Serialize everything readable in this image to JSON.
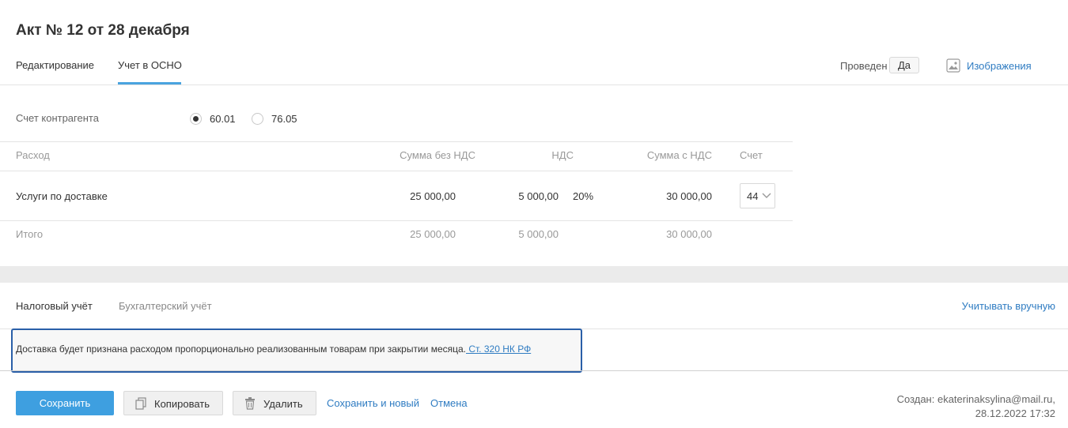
{
  "header": {
    "title": "Акт № 12 от 28 декабря",
    "tabs": [
      "Редактирование",
      "Учет в ОСНО"
    ],
    "posted_label": "Проведен",
    "posted_value": "Да",
    "images_link": "Изображения"
  },
  "counterparty_account": {
    "label": "Счет контрагента",
    "options": [
      "60.01",
      "76.05"
    ],
    "selected": "60.01"
  },
  "table": {
    "columns": [
      "Расход",
      "Сумма без НДС",
      "НДС",
      "Сумма с НДС",
      "Счет"
    ],
    "rows": [
      {
        "expense": "Услуги по доставке",
        "amount_no_vat": "25 000,00",
        "vat": "5 000,00",
        "vat_rate": "20%",
        "amount_with_vat": "30 000,00",
        "account": "44"
      }
    ],
    "total": {
      "label": "Итого",
      "amount_no_vat": "25 000,00",
      "vat": "5 000,00",
      "amount_with_vat": "30 000,00"
    }
  },
  "accounting_tabs": {
    "tabs": [
      "Налоговый учёт",
      "Бухгалтерский учёт"
    ],
    "active": "Налоговый учёт",
    "manual_link": "Учитывать вручную"
  },
  "note": {
    "text": "Доставка будет признана расходом пропорционально реализованным товарам при закрытии месяца.",
    "link": " Ст. 320 НК РФ"
  },
  "footer": {
    "save": "Сохранить",
    "copy": "Копировать",
    "delete": "Удалить",
    "save_new": "Сохранить и новый",
    "cancel": "Отмена",
    "created_line1": "Создан: ekaterinaksylina@mail.ru,",
    "created_line2": "28.12.2022 17:32"
  },
  "colors": {
    "accent": "#3e9fe0",
    "link": "#2f7cc2",
    "highlight_border": "#2a5fa8"
  }
}
